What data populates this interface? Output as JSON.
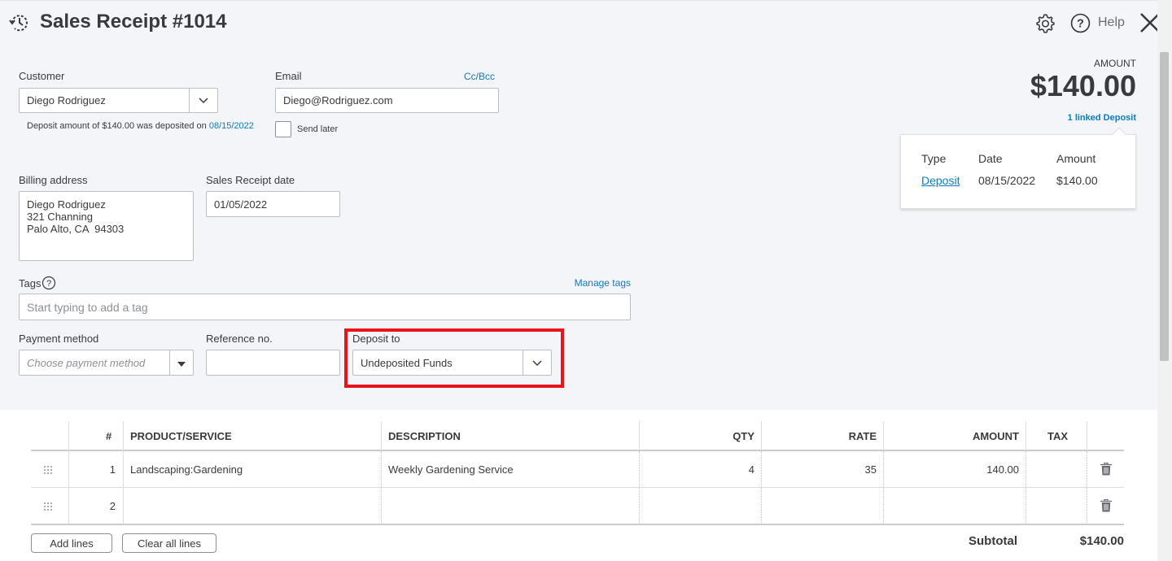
{
  "header": {
    "title": "Sales Receipt #1014",
    "help_label": "Help"
  },
  "customer": {
    "label": "Customer",
    "value": "Diego Rodriguez",
    "deposit_note": "Deposit amount of $140.00 was deposited on",
    "deposit_note_date": "08/15/2022"
  },
  "email": {
    "label": "Email",
    "ccbcc": "Cc/Bcc",
    "value": "Diego@Rodriguez.com",
    "send_later": "Send later"
  },
  "amount": {
    "label": "AMOUNT",
    "value": "$140.00",
    "linked": "1 linked Deposit"
  },
  "linked_deposit": {
    "headers": [
      "Type",
      "Date",
      "Amount"
    ],
    "row": {
      "type": "Deposit",
      "date": "08/15/2022",
      "amount": "$140.00"
    }
  },
  "billing": {
    "label": "Billing address",
    "lines": [
      "Diego Rodriguez",
      "321 Channing",
      "Palo Alto, CA  94303"
    ]
  },
  "receipt_date": {
    "label": "Sales Receipt date",
    "value": "01/05/2022"
  },
  "tags": {
    "label": "Tags",
    "manage": "Manage tags",
    "placeholder": "Start typing to add a tag"
  },
  "payment_method": {
    "label": "Payment method",
    "placeholder": "Choose payment method"
  },
  "reference": {
    "label": "Reference no.",
    "value": ""
  },
  "deposit_to": {
    "label": "Deposit to",
    "value": "Undeposited Funds"
  },
  "table": {
    "columns": {
      "num": "#",
      "product": "PRODUCT/SERVICE",
      "description": "DESCRIPTION",
      "qty": "QTY",
      "rate": "RATE",
      "amount": "AMOUNT",
      "tax": "TAX"
    },
    "rows": [
      {
        "num": "1",
        "product": "Landscaping:Gardening",
        "description": "Weekly Gardening Service",
        "qty": "4",
        "rate": "35",
        "amount": "140.00"
      },
      {
        "num": "2",
        "product": "",
        "description": "",
        "qty": "",
        "rate": "",
        "amount": ""
      }
    ]
  },
  "buttons": {
    "add_lines": "Add lines",
    "clear_all": "Clear all lines"
  },
  "subtotal": {
    "label": "Subtotal",
    "value": "$140.00"
  },
  "colors": {
    "link": "#0d7bbf",
    "highlight": "#e8141b",
    "panel_bg": "#f4f5f8"
  }
}
